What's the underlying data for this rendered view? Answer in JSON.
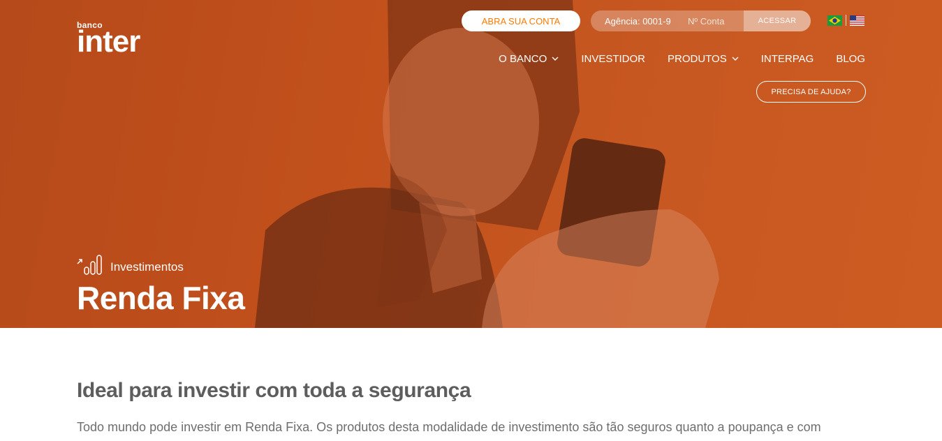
{
  "brand": {
    "small": "banco",
    "big": "inter"
  },
  "header": {
    "open_account_label": "ABRA SUA CONTA",
    "login": {
      "agency_label": "Agência: 0001-9",
      "account_placeholder": "Nº Conta",
      "submit_label": "ACESSAR"
    },
    "languages": [
      "flag-brazil-icon",
      "flag-usa-icon"
    ],
    "nav": [
      {
        "label": "O BANCO",
        "dropdown": true
      },
      {
        "label": "INVESTIDOR",
        "dropdown": false
      },
      {
        "label": "PRODUTOS",
        "dropdown": true
      },
      {
        "label": "INTERPAG",
        "dropdown": false
      },
      {
        "label": "BLOG",
        "dropdown": false
      }
    ],
    "help_label": "PRECISA DE AJUDA?"
  },
  "hero": {
    "category_icon": "investment-chart-icon",
    "category": "Investimentos",
    "title": "Renda Fixa"
  },
  "content": {
    "heading": "Ideal para investir com toda a segurança",
    "paragraph": "Todo mundo pode investir em Renda Fixa. Os produtos desta modalidade de investimento são tão seguros quanto a poupança e com"
  },
  "colors": {
    "hero_orange": "#c1501c",
    "accent_orange": "#ff7a00",
    "text_gray": "#5d5d5d"
  }
}
